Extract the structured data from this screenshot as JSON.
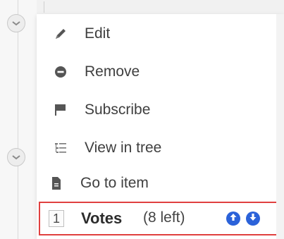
{
  "menu": {
    "items": [
      {
        "label": "Edit",
        "icon": "pencil-icon"
      },
      {
        "label": "Remove",
        "icon": "minus-circle-icon"
      },
      {
        "label": "Subscribe",
        "icon": "flag-icon"
      },
      {
        "label": "View in tree",
        "icon": "tree-list-icon"
      },
      {
        "label": "Go to item",
        "icon": "document-icon"
      }
    ]
  },
  "votes": {
    "count": "1",
    "label": "Votes",
    "remaining": "(8 left)",
    "up_icon": "arrow-up-circle-icon",
    "down_icon": "arrow-down-circle-icon"
  },
  "colors": {
    "highlight_border": "#e0403f",
    "vote_button": "#2b62d9",
    "icon_gray": "#555555"
  }
}
